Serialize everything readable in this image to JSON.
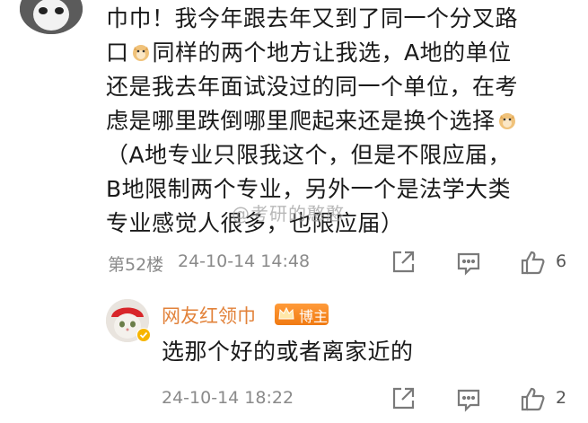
{
  "post": {
    "lines": [
      "巾巾！我今年跟去年又到了同一个分叉路",
      "口",
      "同样的两个地方让我选，A地的单位",
      "还是我去年面试没过的同一个单位，在考",
      "虑是哪里跌倒哪里爬起来还是换个选择",
      "（A地专业只限我这个，但是不限应届，",
      "B地限制两个专业，另外一个是法学大类",
      "专业感觉人很多，也限应届）"
    ],
    "watermark": "@考研的憨憨",
    "floor": "第52楼",
    "timestamp": "24-10-14 14:48",
    "like_count": "6",
    "icons": [
      "share-icon",
      "comment-icon",
      "thumbs-up-icon"
    ]
  },
  "reply": {
    "username": "网友红领巾",
    "badge": "博主",
    "text": "选那个好的或者离家近的",
    "timestamp": "24-10-14 18:22",
    "like_count": "2"
  },
  "colors": {
    "username": "#e2823a",
    "meta": "#8a8a8a",
    "badge": "#f07a12"
  }
}
